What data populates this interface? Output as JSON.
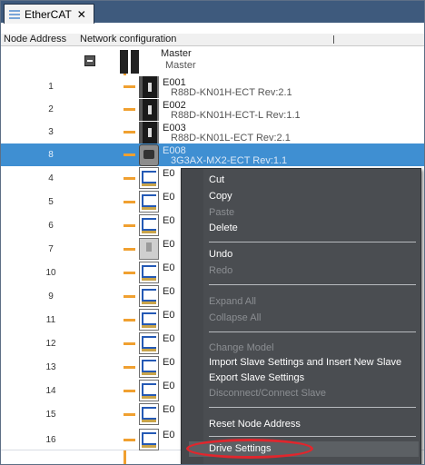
{
  "tab": {
    "label": "EtherCAT",
    "close": "✕"
  },
  "header": {
    "col1": "Node Address",
    "col2": "Network configuration"
  },
  "master": {
    "name": "Master",
    "sub": "Master"
  },
  "rows": [
    {
      "addr": "1",
      "name": "E001",
      "model": "R88D-KN01H-ECT Rev:2.1",
      "icon": "servo-drive-icon"
    },
    {
      "addr": "2",
      "name": "E002",
      "model": "R88D-KN01H-ECT-L Rev:1.1",
      "icon": "servo-drive-icon"
    },
    {
      "addr": "3",
      "name": "E003",
      "model": "R88D-KN01L-ECT Rev:2.1",
      "icon": "servo-drive-icon"
    },
    {
      "addr": "8",
      "name": "E008",
      "model": "3G3AX-MX2-ECT Rev:1.1",
      "icon": "inverter-icon",
      "selected": true
    },
    {
      "addr": "4",
      "name": "E0",
      "model": "",
      "icon": "io-terminal-icon"
    },
    {
      "addr": "5",
      "name": "E0",
      "model": "",
      "icon": "io-terminal-icon"
    },
    {
      "addr": "6",
      "name": "E0",
      "model": "",
      "icon": "io-terminal-icon"
    },
    {
      "addr": "7",
      "name": "E0",
      "model": "",
      "icon": "io-unit-icon"
    },
    {
      "addr": "10",
      "name": "E0",
      "model": "",
      "icon": "io-terminal-icon"
    },
    {
      "addr": "9",
      "name": "E0",
      "model": "",
      "icon": "io-terminal-icon"
    },
    {
      "addr": "11",
      "name": "E0",
      "model": "",
      "icon": "io-terminal-icon"
    },
    {
      "addr": "12",
      "name": "E0",
      "model": "",
      "icon": "io-terminal-icon"
    },
    {
      "addr": "13",
      "name": "E0",
      "model": "",
      "icon": "io-terminal-icon"
    },
    {
      "addr": "14",
      "name": "E0",
      "model": "",
      "icon": "io-terminal-icon"
    },
    {
      "addr": "15",
      "name": "E0",
      "model": "",
      "icon": "io-terminal-icon"
    },
    {
      "addr": "16",
      "name": "E0",
      "model": "",
      "icon": "io-terminal-icon"
    }
  ],
  "context_menu": {
    "cut": "Cut",
    "copy": "Copy",
    "paste": "Paste",
    "delete": "Delete",
    "undo": "Undo",
    "redo": "Redo",
    "expand_all": "Expand All",
    "collapse_all": "Collapse All",
    "change_model": "Change Model",
    "import_slave": "Import Slave Settings and Insert New Slave",
    "export_slave": "Export Slave Settings",
    "disconnect": "Disconnect/Connect Slave",
    "reset_node": "Reset Node Address",
    "drive_settings": "Drive Settings"
  },
  "colors": {
    "selection": "#3f8fd2",
    "menu_bg": "#4a4d51",
    "highlight_ring": "#e0262d",
    "wire": "#f0a030"
  }
}
